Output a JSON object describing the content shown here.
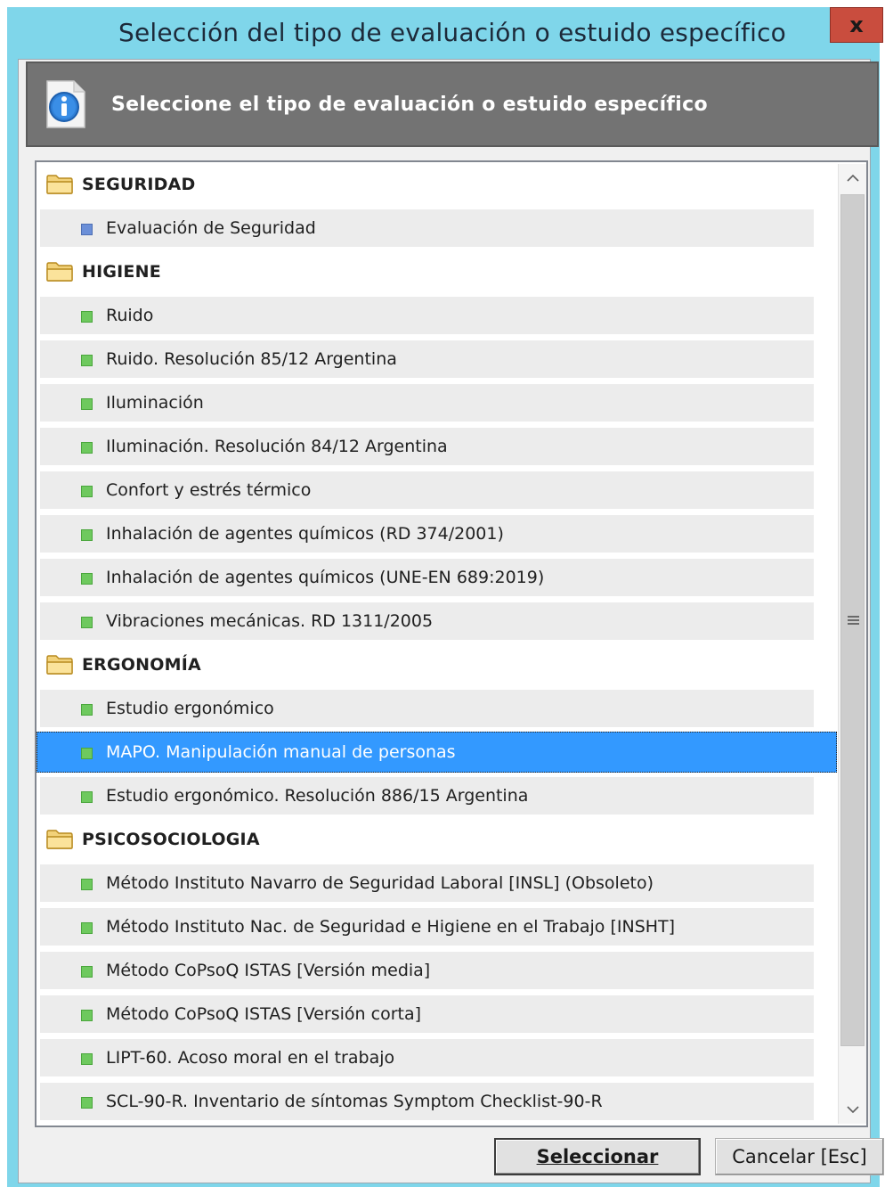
{
  "window": {
    "title": "Selección del tipo de evaluación o estuido específico",
    "close_label": "x"
  },
  "header": {
    "icon": "info-icon",
    "text": "Seleccione el tipo de evaluación o estuido específico"
  },
  "list": {
    "categories": [
      {
        "label": "SEGURIDAD",
        "items": [
          {
            "label": "Evaluación de Seguridad",
            "bullet": "blue"
          }
        ]
      },
      {
        "label": "HIGIENE",
        "items": [
          {
            "label": "Ruido"
          },
          {
            "label": "Ruido. Resolución 85/12 Argentina"
          },
          {
            "label": "Iluminación"
          },
          {
            "label": "Iluminación. Resolución 84/12 Argentina"
          },
          {
            "label": "Confort y estrés térmico"
          },
          {
            "label": "Inhalación de agentes químicos (RD 374/2001)"
          },
          {
            "label": "Inhalación de agentes químicos (UNE-EN 689:2019)"
          },
          {
            "label": "Vibraciones mecánicas. RD 1311/2005"
          }
        ]
      },
      {
        "label": "ERGONOMÍA",
        "items": [
          {
            "label": "Estudio ergonómico"
          },
          {
            "label": "MAPO. Manipulación manual de personas",
            "selected": true
          },
          {
            "label": "Estudio ergonómico. Resolución 886/15 Argentina"
          }
        ]
      },
      {
        "label": "PSICOSOCIOLOGIA",
        "items": [
          {
            "label": "Método Instituto Navarro de Seguridad Laboral  [INSL]  (Obsoleto)"
          },
          {
            "label": "Método Instituto Nac. de Seguridad e Higiene en el Trabajo  [INSHT]"
          },
          {
            "label": "Método CoPsoQ ISTAS  [Versión media]"
          },
          {
            "label": "Método CoPsoQ ISTAS  [Versión corta]"
          },
          {
            "label": "LIPT-60. Acoso moral en el trabajo"
          },
          {
            "label": "SCL-90-R. Inventario de síntomas Symptom Checklist-90-R"
          }
        ]
      }
    ]
  },
  "buttons": {
    "select_label": "Seleccionar",
    "cancel_label": "Cancelar  [Esc]"
  },
  "colors": {
    "window_frame": "#7fd6ea",
    "header_bg": "#737373",
    "selection": "#3399ff",
    "bullet_green": "#6ec95e",
    "bullet_blue": "#6b8fd8"
  }
}
